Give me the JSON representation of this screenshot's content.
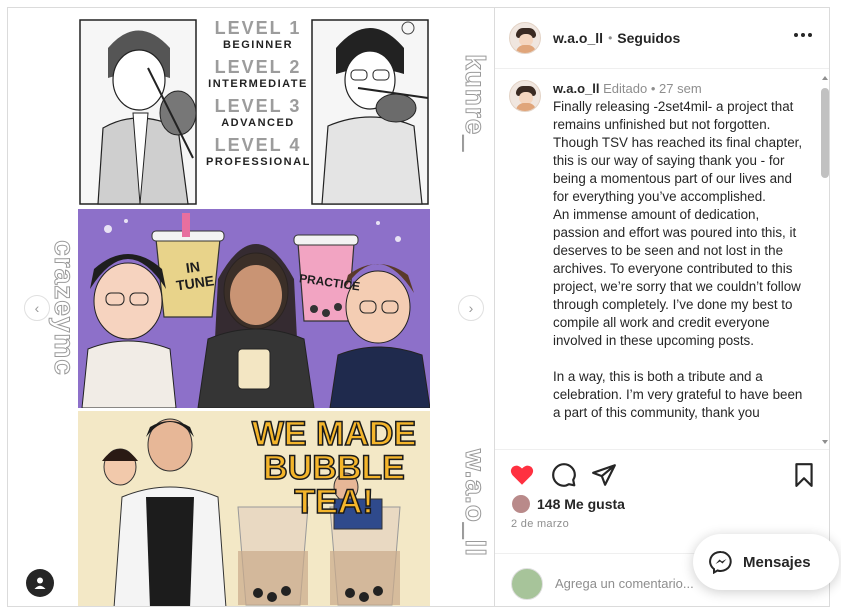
{
  "media": {
    "watermark_top_right": "kunre_",
    "watermark_left": "crazeymc",
    "watermark_bottom_right": "w.a.o_ll",
    "levels": [
      {
        "num": "LEVEL 1",
        "name": "BEGINNER"
      },
      {
        "num": "LEVEL 2",
        "name": "INTERMEDIATE"
      },
      {
        "num": "LEVEL 3",
        "name": "ADVANCED"
      },
      {
        "num": "LEVEL 4",
        "name": "PROFESSIONAL"
      }
    ],
    "cup_left_text": "IN TUNE",
    "cup_right_text": "PRACTICE",
    "headline_line1": "WE MADE",
    "headline_line2": "BUBBLE TEA!"
  },
  "header": {
    "username": "w.a.o_ll",
    "separator": "•",
    "follow_status": "Seguidos"
  },
  "caption": {
    "username": "w.a.o_ll",
    "edited": "Editado",
    "separator": "•",
    "time": "27 sem",
    "paragraph1": "Finally releasing -2set4mil- a project that remains unfinished but not forgotten. Though TSV has reached its final chapter, this is our way of saying thank you - for being a momentous part of our lives and for everything you’ve accomplished.",
    "paragraph2": "An immense amount of dedication, passion and effort was poured into this, it deserves to be seen and not lost in the archives. To everyone contributed to this project, we’re sorry that we couldn’t follow through completely. I’ve done my best to compile all work and credit everyone involved in these upcoming posts.",
    "paragraph3": "In a way, this is both a tribute and a celebration. I’m very grateful to have been a part of this community, thank you"
  },
  "stats": {
    "likes": "148 Me gusta",
    "date": "2 de marzo"
  },
  "comment": {
    "placeholder": "Agrega un comentario..."
  },
  "messages": {
    "label": "Mensajes"
  },
  "colors": {
    "like_red": "#ff3040",
    "text": "#262626",
    "muted": "#8e8e8e"
  }
}
